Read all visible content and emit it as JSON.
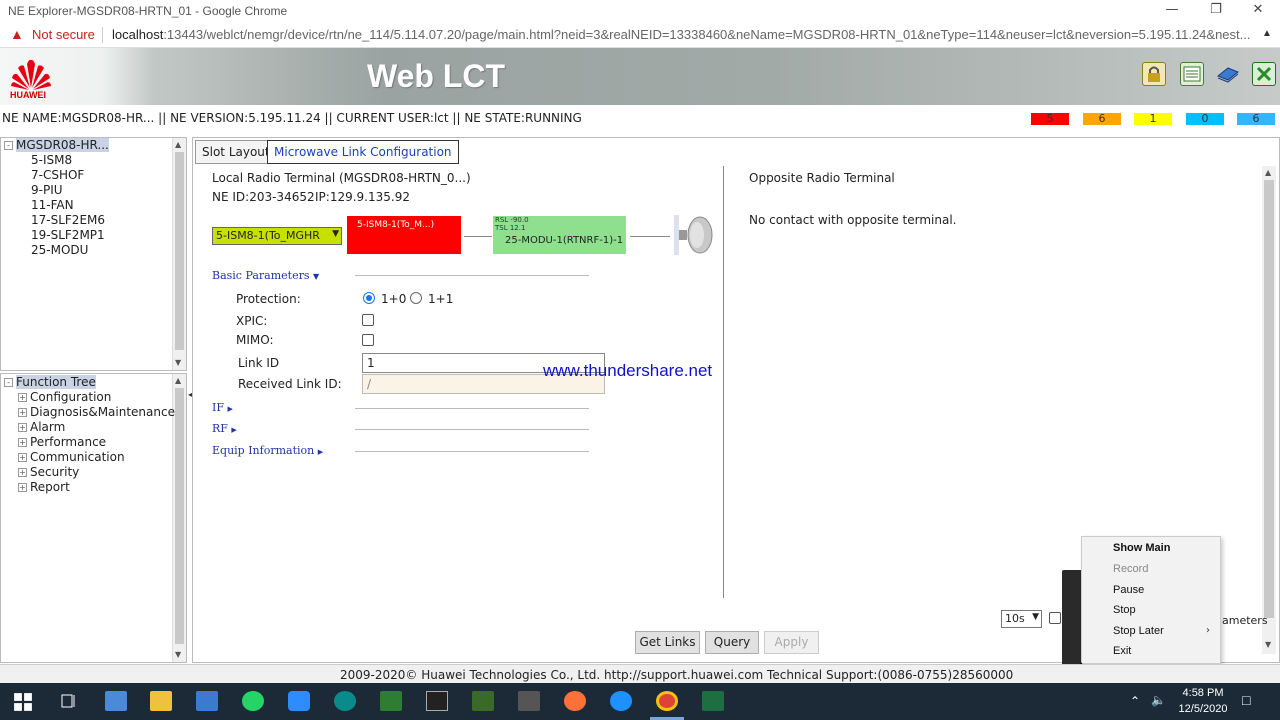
{
  "browser": {
    "window_title": "NE Explorer-MGSDR08-HRTN_01 - Google Chrome",
    "security_label": "Not secure",
    "url_host": "localhost",
    "url_path": ":13443/weblct/nemgr/device/rtn/ne_114/5.114.07.20/page/main.html?neid=3&realNEID=13338460&neName=MGSDR08-HRTN_01&neType=114&neuser=lct&neversion=5.195.11.24&nest..."
  },
  "banner": {
    "brand": "HUAWEI",
    "app_title": "Web LCT"
  },
  "status_line": "NE NAME:MGSDR08-HR... || NE VERSION:5.195.11.24 || CURRENT USER:lct || NE STATE:RUNNING",
  "alarms": [
    {
      "count": "5",
      "color": "#ff0000"
    },
    {
      "count": "6",
      "color": "#ffa500"
    },
    {
      "count": "1",
      "color": "#ffff00"
    },
    {
      "count": "0",
      "color": "#00bfff"
    },
    {
      "count": "6",
      "color": "#33b5ff"
    }
  ],
  "ne_tree": {
    "root": "MGSDR08-HR...",
    "items": [
      "5-ISM8",
      "7-CSHOF",
      "9-PIU",
      "11-FAN",
      "17-SLF2EM6",
      "19-SLF2MP1",
      "25-MODU"
    ]
  },
  "function_tree": {
    "root": "Function Tree",
    "items": [
      "Configuration",
      "Diagnosis&Maintenance",
      "Alarm",
      "Performance",
      "Communication",
      "Security",
      "Report"
    ]
  },
  "tabs": [
    "Slot Layout",
    "Microwave Link Configuration"
  ],
  "local": {
    "title": "Local Radio Terminal (MGSDR08-HRTN_0...)",
    "ne_id": "NE ID:203-34652",
    "ip": "IP:129.9.135.92",
    "board_select": "5-ISM8-1(To_MGHR",
    "if_box_label": "5-ISM8-1(To_M...)",
    "rsl": "RSL -90.0",
    "tsl": "TSL 12.1",
    "odu_label": "25-MODU-1(RTNRF-1)-1"
  },
  "sections": {
    "basic": "Basic Parameters",
    "if": "IF",
    "rf": "RF",
    "equip": "Equip Information"
  },
  "params": {
    "protection_label": "Protection:",
    "protection_opt1": "1+0",
    "protection_opt2": "1+1",
    "xpic_label": "XPIC:",
    "mimo_label": "MIMO:",
    "link_id_label": "Link ID",
    "link_id_value": "1",
    "recv_link_id_label": "Received Link ID:",
    "recv_link_id_value": "/"
  },
  "watermark": "www.thundershare.net",
  "opposite": {
    "title": "Opposite Radio Terminal",
    "message": "No contact with opposite terminal."
  },
  "refresh_select": "10s",
  "partial_label": "ameters",
  "buttons": {
    "get_links": "Get Links",
    "query": "Query",
    "apply": "Apply"
  },
  "context_menu": [
    "Show Main",
    "Record",
    "Pause",
    "Stop",
    "Stop Later",
    "Exit"
  ],
  "footer": "2009-2020© Huawei Technologies Co., Ltd. http://support.huawei.com Technical Support:(0086-0755)28560000",
  "clock": {
    "time": "4:58 PM",
    "date": "12/5/2020"
  }
}
